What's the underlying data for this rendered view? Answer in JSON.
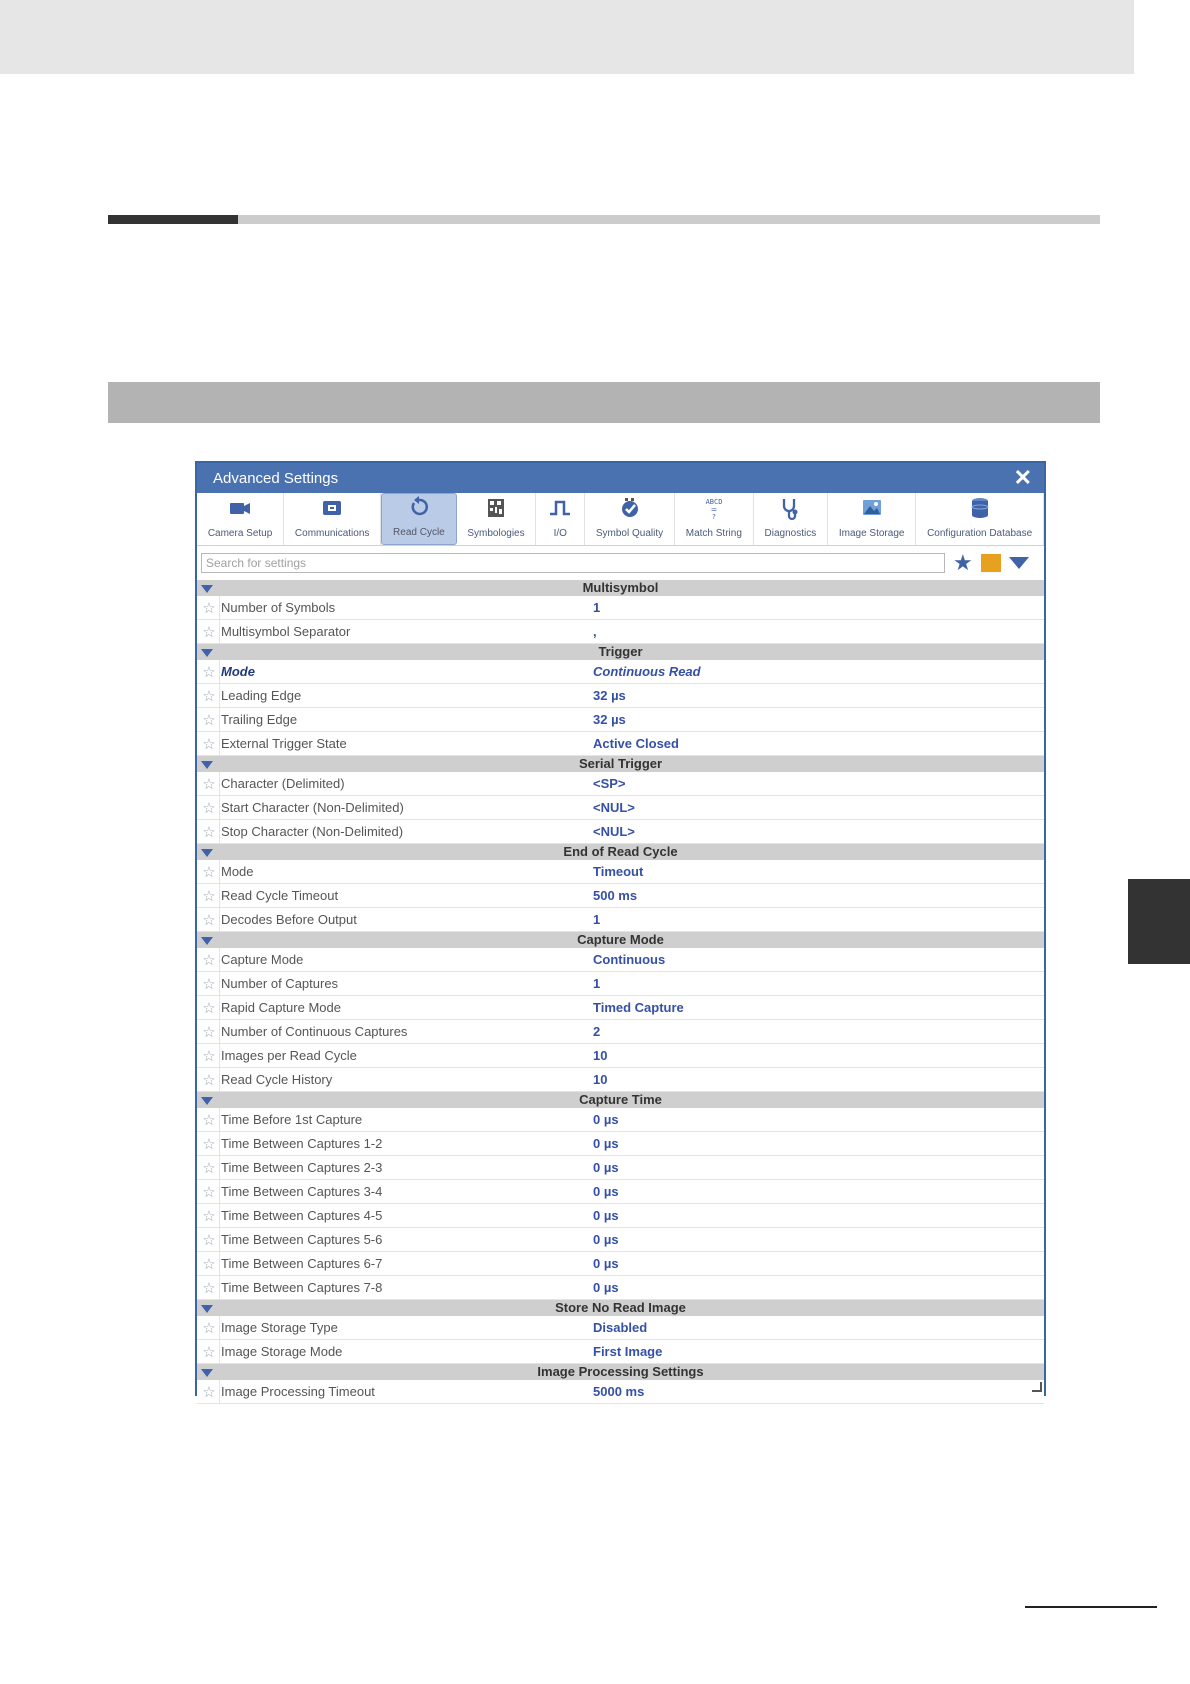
{
  "dialog": {
    "title": "Advanced Settings",
    "close_symbol": "✕"
  },
  "toolbar": [
    {
      "label": "Camera Setup",
      "icon": "camera-icon",
      "active": false
    },
    {
      "label": "Communications",
      "icon": "communications-icon",
      "active": false
    },
    {
      "label": "Read Cycle",
      "icon": "read-cycle-icon",
      "active": true
    },
    {
      "label": "Symbologies",
      "icon": "symbologies-icon",
      "active": false
    },
    {
      "label": "I/O",
      "icon": "io-pulse-icon",
      "active": false
    },
    {
      "label": "Symbol Quality",
      "icon": "symbol-quality-icon",
      "active": false
    },
    {
      "label": "Match String",
      "icon": "match-string-icon",
      "active": false
    },
    {
      "label": "Diagnostics",
      "icon": "stethoscope-icon",
      "active": false
    },
    {
      "label": "Image Storage",
      "icon": "image-storage-icon",
      "active": false
    },
    {
      "label": "Configuration Database",
      "icon": "database-icon",
      "active": false
    }
  ],
  "search": {
    "placeholder": "Search for settings"
  },
  "colors": {
    "accent": "#3f63a6",
    "titlebar": "#4a72b0",
    "value_text": "#3550a8",
    "section_header": "#cfcfcf"
  },
  "sections": [
    {
      "title": "Multisymbol",
      "rows": [
        {
          "label": "Number of Symbols",
          "value": "1"
        },
        {
          "label": "Multisymbol Separator",
          "value": ","
        }
      ]
    },
    {
      "title": "Trigger",
      "rows": [
        {
          "label": "Mode",
          "value": "Continuous Read",
          "emphasis": true
        },
        {
          "label": "Leading Edge",
          "value": "32 µs"
        },
        {
          "label": "Trailing Edge",
          "value": "32 µs"
        },
        {
          "label": "External Trigger State",
          "value": "Active Closed"
        }
      ]
    },
    {
      "title": "Serial Trigger",
      "rows": [
        {
          "label": "Character (Delimited)",
          "value": "<SP>"
        },
        {
          "label": "Start Character (Non-Delimited)",
          "value": "<NUL>"
        },
        {
          "label": "Stop Character (Non-Delimited)",
          "value": "<NUL>"
        }
      ]
    },
    {
      "title": "End of Read Cycle",
      "rows": [
        {
          "label": "Mode",
          "value": "Timeout"
        },
        {
          "label": "Read Cycle Timeout",
          "value": "500 ms"
        },
        {
          "label": "Decodes Before Output",
          "value": "1"
        }
      ]
    },
    {
      "title": "Capture Mode",
      "rows": [
        {
          "label": "Capture Mode",
          "value": "Continuous"
        },
        {
          "label": "Number of Captures",
          "value": "1"
        },
        {
          "label": "Rapid Capture Mode",
          "value": "Timed Capture"
        },
        {
          "label": "Number of Continuous Captures",
          "value": "2"
        },
        {
          "label": "Images per Read Cycle",
          "value": "10"
        },
        {
          "label": "Read Cycle History",
          "value": "10"
        }
      ]
    },
    {
      "title": "Capture Time",
      "rows": [
        {
          "label": "Time Before 1st Capture",
          "value": "0 µs"
        },
        {
          "label": "Time Between Captures 1-2",
          "value": "0 µs"
        },
        {
          "label": "Time Between Captures 2-3",
          "value": "0 µs"
        },
        {
          "label": "Time Between Captures 3-4",
          "value": "0 µs"
        },
        {
          "label": "Time Between Captures 4-5",
          "value": "0 µs"
        },
        {
          "label": "Time Between Captures 5-6",
          "value": "0 µs"
        },
        {
          "label": "Time Between Captures 6-7",
          "value": "0 µs"
        },
        {
          "label": "Time Between Captures 7-8",
          "value": "0 µs"
        }
      ]
    },
    {
      "title": "Store No Read Image",
      "rows": [
        {
          "label": "Image Storage Type",
          "value": "Disabled"
        },
        {
          "label": "Image Storage Mode",
          "value": "First Image"
        }
      ]
    },
    {
      "title": "Image Processing Settings",
      "rows": [
        {
          "label": "Image Processing Timeout",
          "value": "5000 ms"
        }
      ]
    }
  ]
}
